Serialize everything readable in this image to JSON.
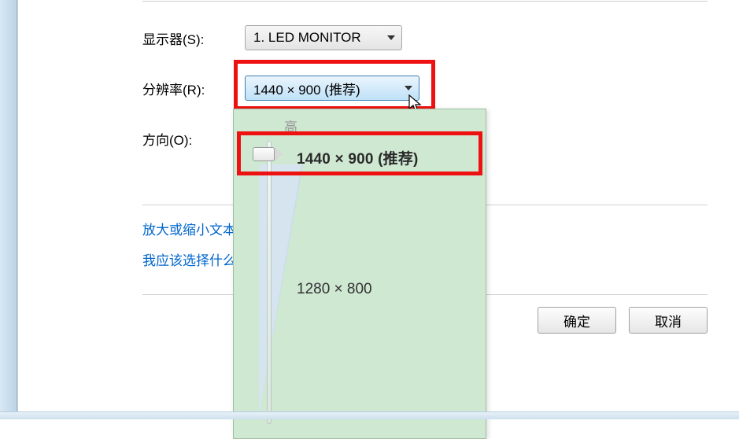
{
  "labels": {
    "monitor": "显示器(S):",
    "resolution": "分辨率(R):",
    "orientation": "方向(O):"
  },
  "monitor": {
    "selected": "1. LED MONITOR"
  },
  "resolution": {
    "selected": "1440 × 900 (推荐)",
    "popup_header": "高",
    "options": {
      "recommended": "1440 × 900 (推荐)",
      "mid": "1280 × 800"
    }
  },
  "links": {
    "zoom_text": "放大或缩小文本",
    "which_settings": "我应该选择什么"
  },
  "buttons": {
    "ok": "确定",
    "cancel": "取消"
  }
}
